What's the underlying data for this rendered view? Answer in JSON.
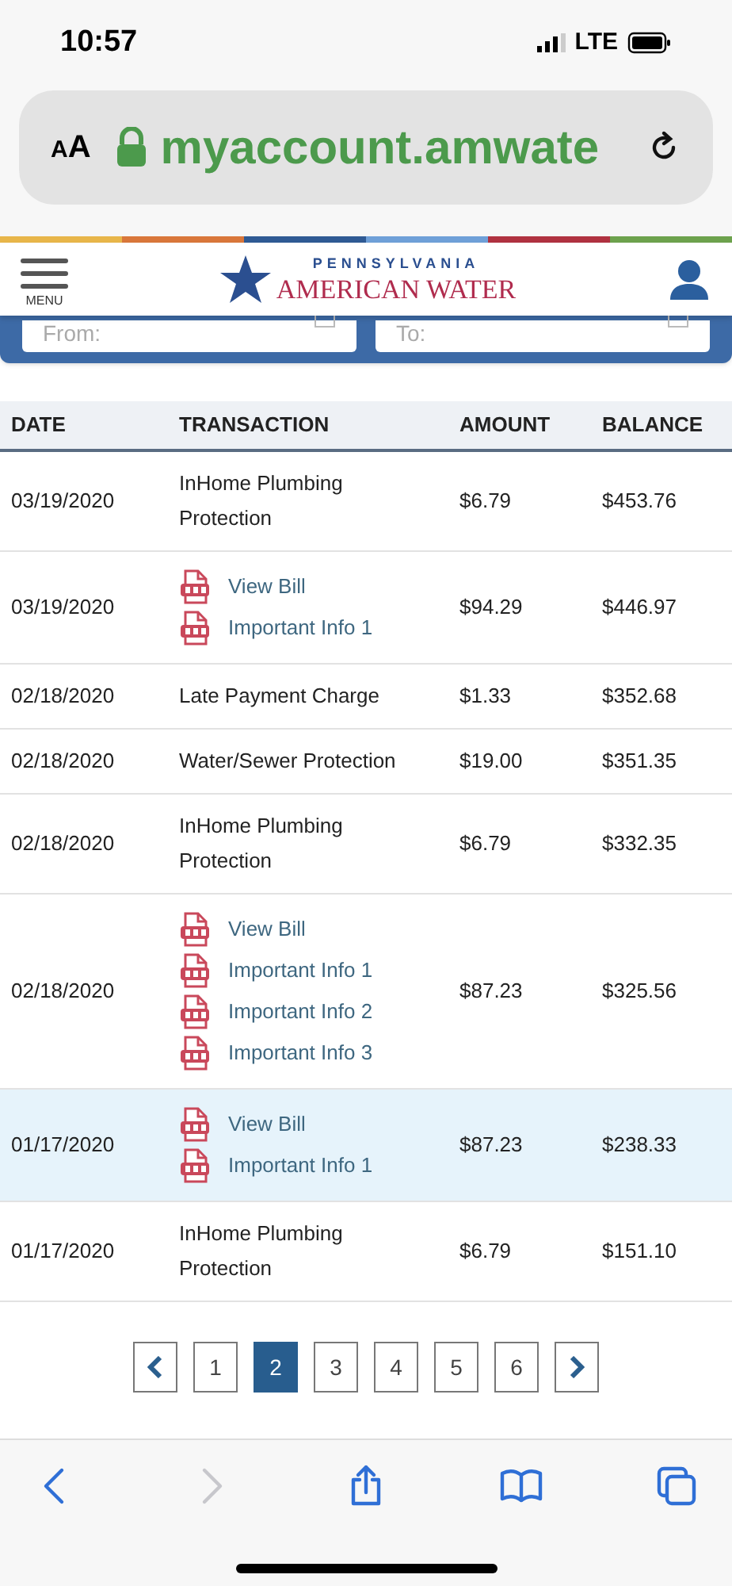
{
  "status_bar": {
    "time": "10:57",
    "network": "LTE"
  },
  "address_bar": {
    "text_size_button": "AA",
    "url": "myaccount.amwate"
  },
  "header": {
    "menu_label": "MENU",
    "logo_top": "PENNSYLVANIA",
    "logo_bottom": "AMERICAN WATER"
  },
  "filters": [
    {
      "placeholder": "From:"
    },
    {
      "placeholder": "To:"
    }
  ],
  "table": {
    "columns": [
      "DATE",
      "TRANSACTION",
      "AMOUNT",
      "BALANCE"
    ],
    "rows": [
      {
        "date": "03/19/2020",
        "transaction": {
          "kind": "text",
          "text": "InHome Plumbing Protection"
        },
        "amount": "$6.79",
        "balance": "$453.76",
        "selected": false
      },
      {
        "date": "03/19/2020",
        "transaction": {
          "kind": "documents",
          "links": [
            "View Bill",
            "Important Info 1"
          ]
        },
        "amount": "$94.29",
        "balance": "$446.97",
        "selected": false
      },
      {
        "date": "02/18/2020",
        "transaction": {
          "kind": "text",
          "text": "Late Payment Charge"
        },
        "amount": "$1.33",
        "balance": "$352.68",
        "selected": false
      },
      {
        "date": "02/18/2020",
        "transaction": {
          "kind": "text",
          "text": "Water/Sewer Protection"
        },
        "amount": "$19.00",
        "balance": "$351.35",
        "selected": false
      },
      {
        "date": "02/18/2020",
        "transaction": {
          "kind": "text",
          "text": "InHome Plumbing Protection"
        },
        "amount": "$6.79",
        "balance": "$332.35",
        "selected": false
      },
      {
        "date": "02/18/2020",
        "transaction": {
          "kind": "documents",
          "links": [
            "View Bill",
            "Important Info 1",
            "Important Info 2",
            "Important Info 3"
          ]
        },
        "amount": "$87.23",
        "balance": "$325.56",
        "selected": false
      },
      {
        "date": "01/17/2020",
        "transaction": {
          "kind": "documents",
          "links": [
            "View Bill",
            "Important Info 1"
          ]
        },
        "amount": "$87.23",
        "balance": "$238.33",
        "selected": true
      },
      {
        "date": "01/17/2020",
        "transaction": {
          "kind": "text",
          "text": "InHome Plumbing Protection"
        },
        "amount": "$6.79",
        "balance": "$151.10",
        "selected": false
      }
    ]
  },
  "pagination": {
    "pages": [
      {
        "label": "1",
        "selected": false
      },
      {
        "label": "2",
        "selected": true
      },
      {
        "label": "3",
        "selected": false
      },
      {
        "label": "4",
        "selected": false
      },
      {
        "label": "5",
        "selected": false
      },
      {
        "label": "6",
        "selected": false
      }
    ]
  },
  "browser_toolbar": [
    {
      "kind": "back",
      "disabled": false
    },
    {
      "kind": "forward",
      "disabled": true
    },
    {
      "kind": "share",
      "disabled": false
    },
    {
      "kind": "bookmarks",
      "disabled": false
    },
    {
      "kind": "tabs",
      "disabled": false
    }
  ]
}
